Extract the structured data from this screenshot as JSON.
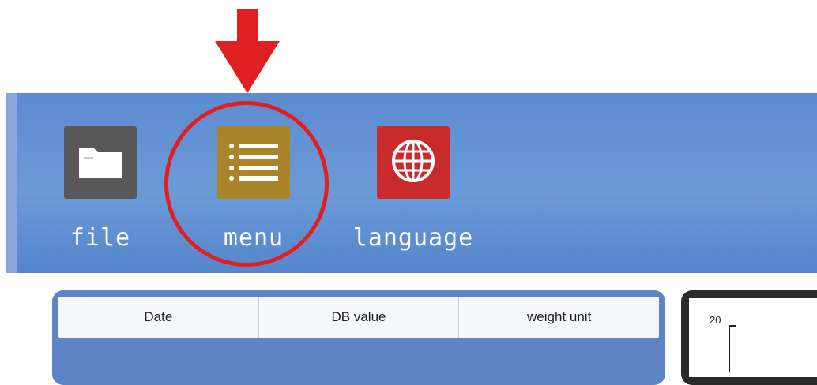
{
  "toolbar": {
    "items": [
      {
        "label": "file",
        "icon": "folder-icon",
        "color": "#585858"
      },
      {
        "label": "menu",
        "icon": "list-icon",
        "color": "#a98428"
      },
      {
        "label": "language",
        "icon": "globe-icon",
        "color": "#c92a2a"
      }
    ]
  },
  "table": {
    "columns": [
      "Date",
      "DB value",
      "weight unit"
    ]
  },
  "chart": {
    "y_top_tick": "20"
  },
  "annotation": {
    "color": "#e02020",
    "highlighted_item": "menu"
  }
}
